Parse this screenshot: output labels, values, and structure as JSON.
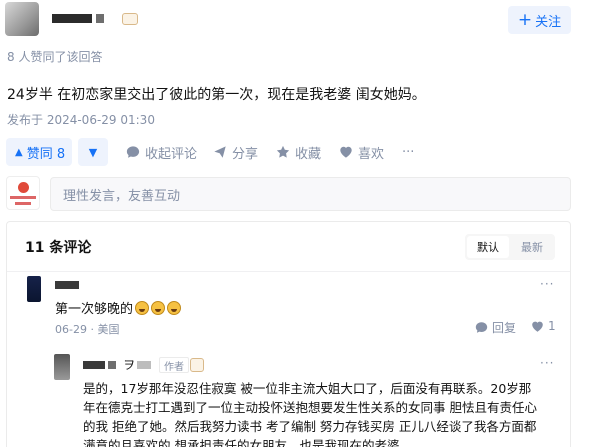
{
  "header": {
    "follow_label": "关注",
    "follow_icon": "plus-icon"
  },
  "endorse_text": "8 人赞同了该回答",
  "answer": {
    "content": "24岁半 在初恋家里交出了彼此的第一次，现在是我老婆 闺女她妈。",
    "published": "发布于 2024-06-29 01:30"
  },
  "actions": {
    "vote_up_label": "赞同 8",
    "vote_down_icon": "triangle-down-icon",
    "comments_label": "收起评论",
    "share_label": "分享",
    "collect_label": "收藏",
    "like_label": "喜欢",
    "more_label": "···"
  },
  "comment_box": {
    "placeholder": "理性发言，友善互动"
  },
  "comments": {
    "count_label": "11 条评论",
    "sort_default": "默认",
    "sort_latest": "最新",
    "items": [
      {
        "text": "第一次够晚的",
        "meta": "06-29 · 美国",
        "reply_label": "回复",
        "like_count": "1",
        "more": "···"
      },
      {
        "name_glyph": "ヲ",
        "author_tag": "作者",
        "more": "···",
        "text_lines": [
          "是的，17岁那年没忍住寂寞 被一位非主流大姐大口了，后面没有再联系。20岁那",
          "年在德克士打工遇到了一位主动投怀送抱想要发生性关系的女同事 胆怯且有责任心",
          "的我 拒绝了她。然后我努力读书 考了编制 努力存钱买房 正儿八经谈了我各方面都",
          "满意的且喜欢的 想承担责任的女朋友，也是我现在的老婆。"
        ]
      }
    ]
  }
}
